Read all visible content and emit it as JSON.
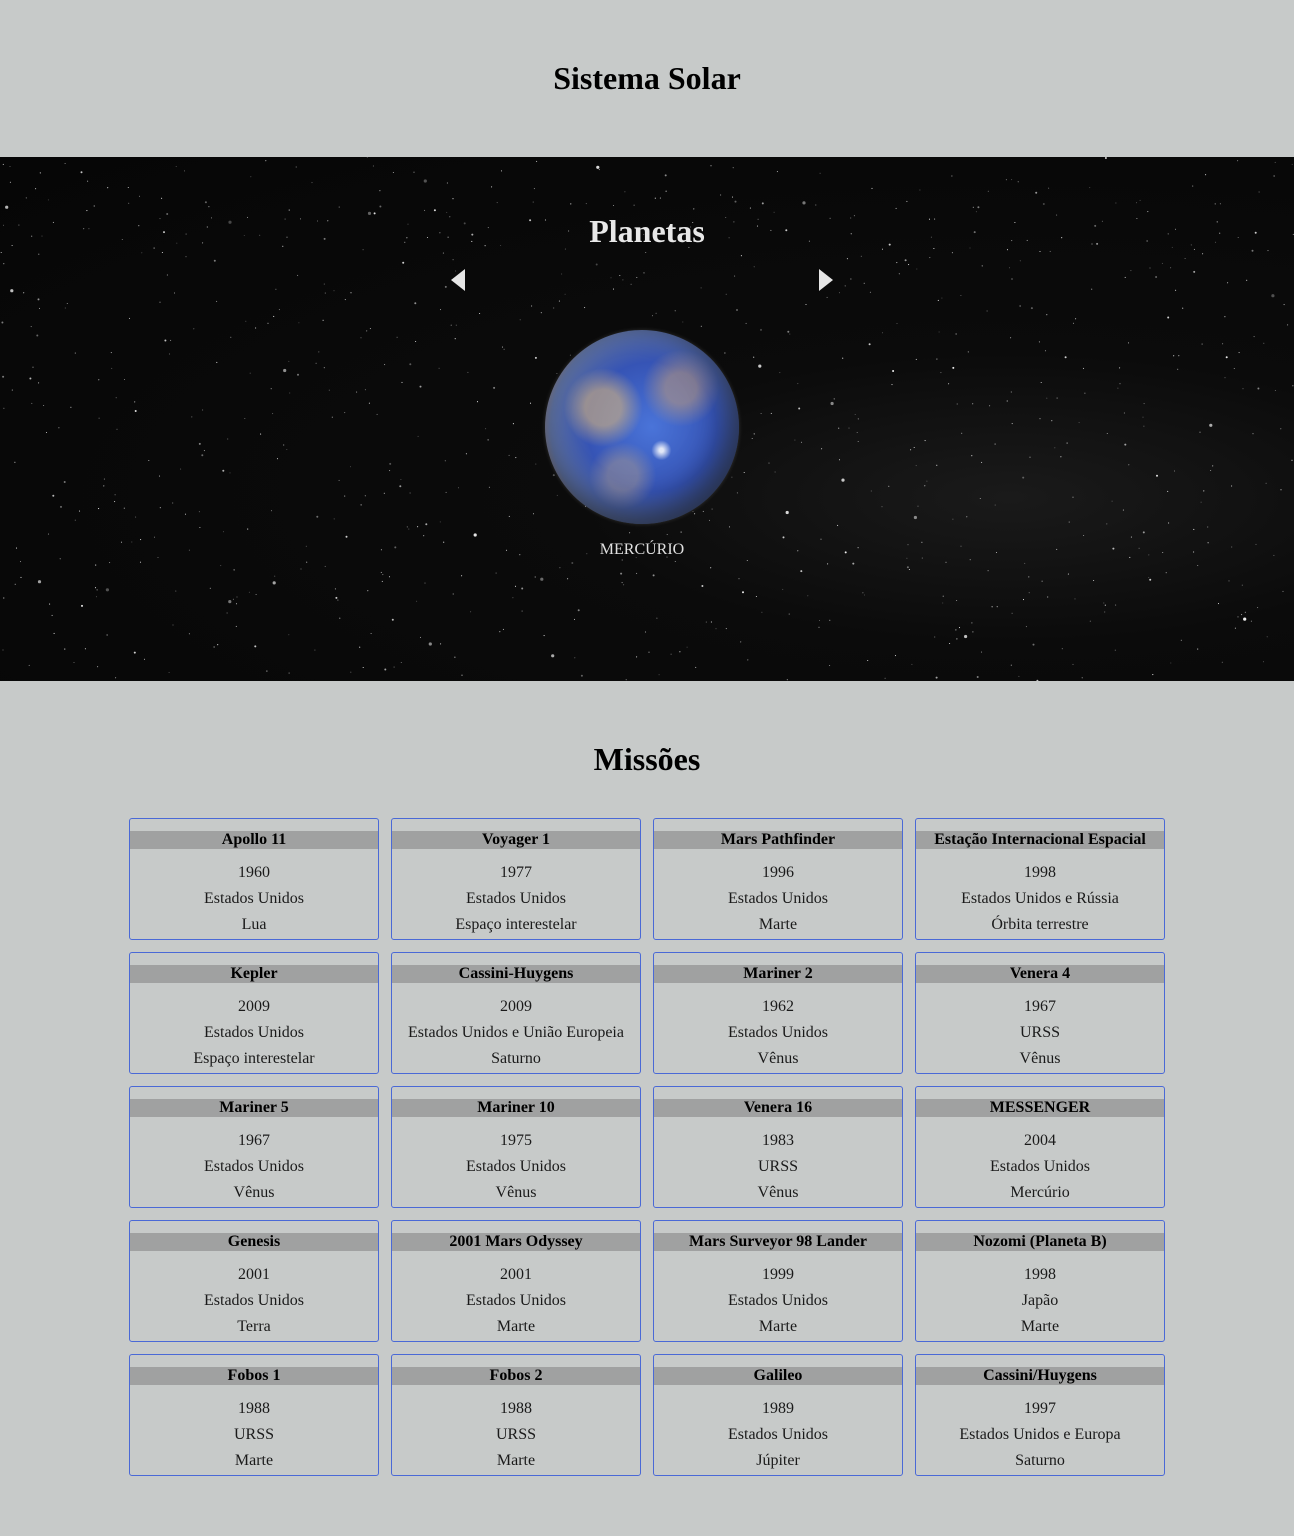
{
  "header": {
    "title": "Sistema Solar"
  },
  "planets": {
    "title": "Planetas",
    "current_planet": "MERCÚRIO",
    "prev_icon": "triangle-left",
    "next_icon": "triangle-right"
  },
  "missions": {
    "title": "Missões",
    "items": [
      {
        "name": "Apollo 11",
        "year": "1960",
        "country": "Estados Unidos",
        "destination": "Lua"
      },
      {
        "name": "Voyager 1",
        "year": "1977",
        "country": "Estados Unidos",
        "destination": "Espaço interestelar"
      },
      {
        "name": "Mars Pathfinder",
        "year": "1996",
        "country": "Estados Unidos",
        "destination": "Marte"
      },
      {
        "name": "Estação Internacional Espacial",
        "year": "1998",
        "country": "Estados Unidos e Rússia",
        "destination": "Órbita terrestre"
      },
      {
        "name": "Kepler",
        "year": "2009",
        "country": "Estados Unidos",
        "destination": "Espaço interestelar"
      },
      {
        "name": "Cassini-Huygens",
        "year": "2009",
        "country": "Estados Unidos e União Europeia",
        "destination": "Saturno"
      },
      {
        "name": "Mariner 2",
        "year": "1962",
        "country": "Estados Unidos",
        "destination": "Vênus"
      },
      {
        "name": "Venera 4",
        "year": "1967",
        "country": "URSS",
        "destination": "Vênus"
      },
      {
        "name": "Mariner 5",
        "year": "1967",
        "country": "Estados Unidos",
        "destination": "Vênus"
      },
      {
        "name": "Mariner 10",
        "year": "1975",
        "country": "Estados Unidos",
        "destination": "Vênus"
      },
      {
        "name": "Venera 16",
        "year": "1983",
        "country": "URSS",
        "destination": "Vênus"
      },
      {
        "name": "MESSENGER",
        "year": "2004",
        "country": "Estados Unidos",
        "destination": "Mercúrio"
      },
      {
        "name": "Genesis",
        "year": "2001",
        "country": "Estados Unidos",
        "destination": "Terra"
      },
      {
        "name": "2001 Mars Odyssey",
        "year": "2001",
        "country": "Estados Unidos",
        "destination": "Marte"
      },
      {
        "name": "Mars Surveyor 98 Lander",
        "year": "1999",
        "country": "Estados Unidos",
        "destination": "Marte"
      },
      {
        "name": "Nozomi (Planeta B)",
        "year": "1998",
        "country": "Japão",
        "destination": "Marte"
      },
      {
        "name": "Fobos 1",
        "year": "1988",
        "country": "URSS",
        "destination": "Marte"
      },
      {
        "name": "Fobos 2",
        "year": "1988",
        "country": "URSS",
        "destination": "Marte"
      },
      {
        "name": "Galileo",
        "year": "1989",
        "country": "Estados Unidos",
        "destination": "Júpiter"
      },
      {
        "name": "Cassini/Huygens",
        "year": "1997",
        "country": "Estados Unidos e Europa",
        "destination": "Saturno"
      }
    ]
  },
  "colors": {
    "page_background": "#c7cac9",
    "card_border": "#4a69d6",
    "card_title_background": "#a0a1a1"
  }
}
